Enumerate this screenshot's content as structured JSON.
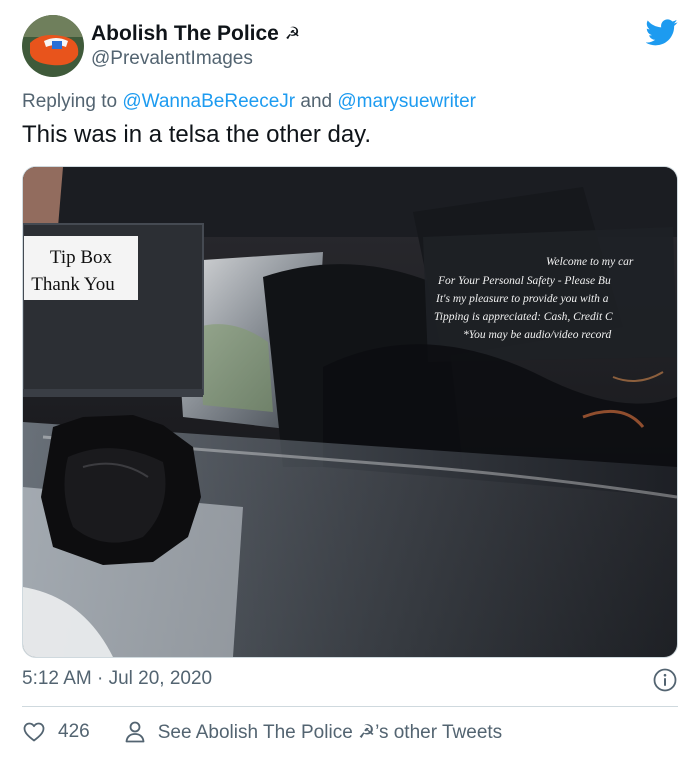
{
  "tweet": {
    "display_name": "Abolish The Police",
    "name_emoji": "☭",
    "handle": "@PrevalentImages",
    "reply_prefix": "Replying to",
    "reply_to": [
      "@WannaBeReeceJr",
      "@marysuewriter"
    ],
    "reply_joiner": "and",
    "text": "This was in a telsa the other day.",
    "timestamp": "5:12 AM · Jul 20, 2020",
    "likes": "426",
    "other_tweets_label": "See Abolish The Police ☭’s other Tweets"
  },
  "photo": {
    "tip_box_line1": "Tip Box",
    "tip_box_line2": "Thank You",
    "sign_lines": [
      "Welcome to my car",
      "For Your Personal Safety - Please Bu",
      "It's my pleasure to provide you with a",
      "Tipping is appreciated: Cash, Credit C",
      "*You may be audio/video record"
    ]
  },
  "icons": {
    "brand": "twitter-bird-icon",
    "info": "info-icon",
    "like": "heart-icon",
    "profile": "person-icon"
  },
  "colors": {
    "accent": "#1d9bf0",
    "text_primary": "#0f1419",
    "text_secondary": "#536471",
    "divider": "#cfd9de"
  }
}
